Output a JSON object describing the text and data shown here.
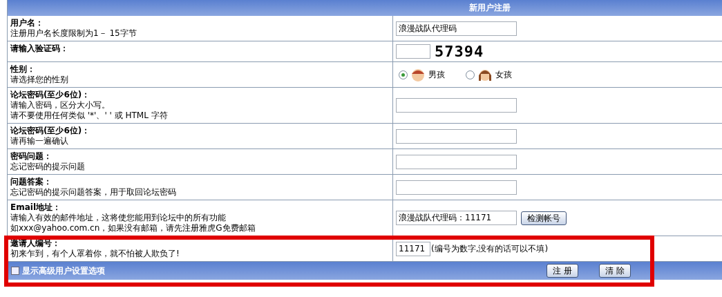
{
  "header": {
    "title": "新用户注册"
  },
  "rows": [
    {
      "kind": "text",
      "label": "用户名：",
      "hints": [
        "注册用户名长度限制为1－ 15字节"
      ],
      "value": "浪漫战队代理码"
    },
    {
      "kind": "captcha",
      "label": "请输入验证码：",
      "captcha_code": "57394"
    },
    {
      "kind": "radio",
      "label": "性别：",
      "hints": [
        "请选择您的性别"
      ],
      "options": [
        {
          "label": "男孩",
          "selected": true
        },
        {
          "label": "女孩",
          "selected": false
        }
      ]
    },
    {
      "kind": "password",
      "label": "论坛密码(至少6位)：",
      "hints": [
        "请输入密码，区分大小写。",
        "请不要使用任何类似 '*'、' ' 或 HTML 字符"
      ]
    },
    {
      "kind": "password",
      "label": "论坛密码(至少6位)：",
      "hints": [
        "请再输一遍确认"
      ]
    },
    {
      "kind": "text",
      "label": "密码问题：",
      "hints": [
        "忘记密码的提示问题"
      ]
    },
    {
      "kind": "text",
      "label": "问题答案：",
      "hints": [
        "忘记密码的提示问题答案，用于取回论坛密码"
      ]
    },
    {
      "kind": "email",
      "label": "Email地址：",
      "hints": [
        "请输入有效的邮件地址，这将使您能用到论坛中的所有功能",
        "如xxx@yahoo.com.cn，如果没有邮箱，请先注册雅虎G免费邮箱"
      ],
      "value": "浪漫战队代理码：11171",
      "button": "检测帐号"
    },
    {
      "kind": "invite",
      "label": "邀请人编号：",
      "hints": [
        "初来乍到，有个人罩着你，就不怕被人欺负了!"
      ],
      "value": "11171",
      "note": "(编号为数字,没有的话可以不填)"
    }
  ],
  "footer": {
    "checkbox": {
      "label": "显示高级用户设置选项",
      "checked": false
    },
    "buttons": [
      "注 册",
      "清 除"
    ]
  }
}
